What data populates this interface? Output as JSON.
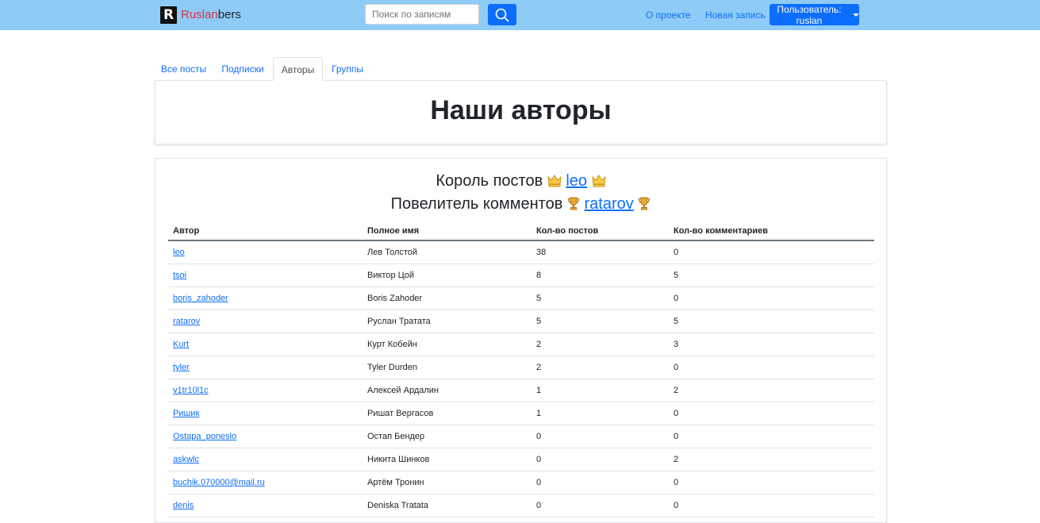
{
  "navbar": {
    "brand_logo_letter": "R",
    "brand_red": "Ruslan",
    "brand_rest": "bers",
    "search_placeholder": "Поиск по записям",
    "links": {
      "about": "О проекте",
      "new_post": "Новая запись"
    },
    "user_button": "Пользователь: ruslan",
    "colors": {
      "navbar_bg": "#8ecbf7",
      "accent": "#0d6efd",
      "brand_red": "#dc3545"
    }
  },
  "tabs": [
    {
      "label": "Все посты",
      "active": false
    },
    {
      "label": "Подписки",
      "active": false
    },
    {
      "label": "Авторы",
      "active": true
    },
    {
      "label": "Группы",
      "active": false
    }
  ],
  "page_title": "Наши авторы",
  "awards": {
    "posts": {
      "label": "Король постов",
      "icon": "crown-icon",
      "user": "leo"
    },
    "comments": {
      "label": "Повелитель комментов",
      "icon": "trophy-icon",
      "user": "ratarov"
    }
  },
  "table": {
    "headers": [
      "Автор",
      "Полное имя",
      "Кол-во постов",
      "Кол-во комментариев"
    ],
    "rows": [
      {
        "author": "leo",
        "full_name": "Лев Толстой",
        "posts": "38",
        "comments": "0"
      },
      {
        "author": "tsoi",
        "full_name": "Виктор Цой",
        "posts": "8",
        "comments": "5"
      },
      {
        "author": "boris_zahoder",
        "full_name": "Boris Zahoder",
        "posts": "5",
        "comments": "0"
      },
      {
        "author": "ratarov",
        "full_name": "Руслан Тратата",
        "posts": "5",
        "comments": "5"
      },
      {
        "author": "Kurt",
        "full_name": "Курт Кобейн",
        "posts": "2",
        "comments": "3"
      },
      {
        "author": "tyler",
        "full_name": "Tyler Durden",
        "posts": "2",
        "comments": "0"
      },
      {
        "author": "v1tr10l1c",
        "full_name": "Алексей Ардалин",
        "posts": "1",
        "comments": "2"
      },
      {
        "author": "Ришик",
        "full_name": "Ришат Вергасов",
        "posts": "1",
        "comments": "0"
      },
      {
        "author": "Ostapa_poneslo",
        "full_name": "Остап Бендер",
        "posts": "0",
        "comments": "0"
      },
      {
        "author": "askwlc",
        "full_name": "Никита Шинков",
        "posts": "0",
        "comments": "2"
      },
      {
        "author": "buchik.070000@mail.ru",
        "full_name": "Артём Тронин",
        "posts": "0",
        "comments": "0"
      },
      {
        "author": "denis",
        "full_name": "Deniska Tratata",
        "posts": "0",
        "comments": "0"
      }
    ]
  }
}
